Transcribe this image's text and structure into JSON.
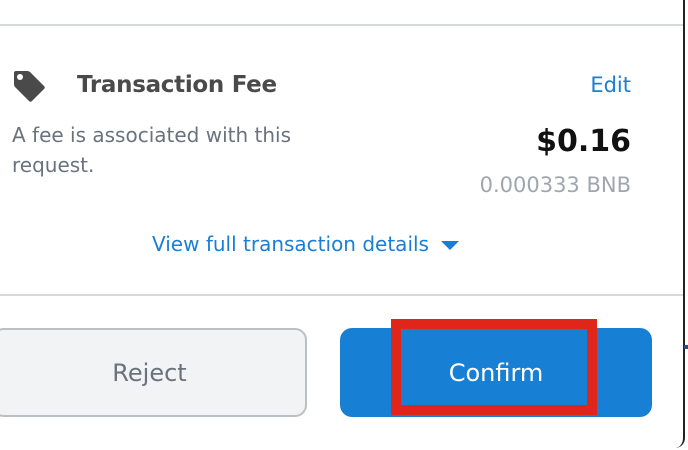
{
  "fee": {
    "icon": "tag-icon",
    "title": "Transaction Fee",
    "edit_label": "Edit",
    "description": "A fee is associated with this request.",
    "fiat_amount": "$0.16",
    "crypto_amount": "0.000333 BNB"
  },
  "details_link": "View full transaction details",
  "buttons": {
    "reject": "Reject",
    "confirm": "Confirm"
  },
  "colors": {
    "accent": "#1780d4",
    "highlight": "#e0261a"
  }
}
